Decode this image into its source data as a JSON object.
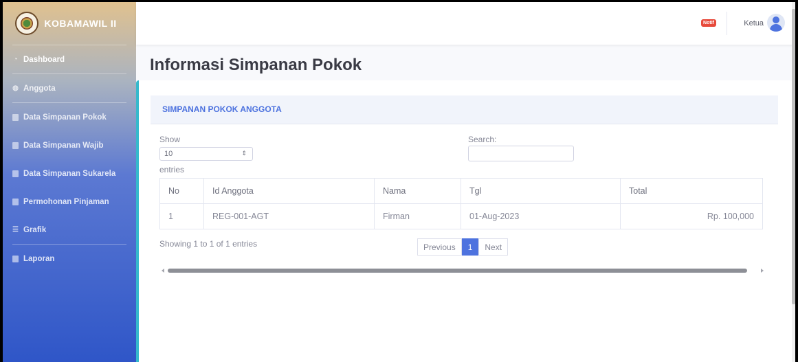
{
  "app": {
    "brand": "KOBAMAWIL II"
  },
  "sidebar": {
    "items": [
      {
        "label": "Dashboard",
        "icon": "dashboard-icon"
      },
      {
        "label": "Anggota",
        "icon": "user-circle-icon"
      },
      {
        "label": "Data Simpanan Pokok",
        "icon": "table-icon"
      },
      {
        "label": "Data Simpanan Wajib",
        "icon": "table-icon"
      },
      {
        "label": "Data Simpanan Sukarela",
        "icon": "table-icon"
      },
      {
        "label": "Permohonan Pinjaman",
        "icon": "file-icon"
      },
      {
        "label": "Grafik",
        "icon": "list-icon"
      },
      {
        "label": "Laporan",
        "icon": "print-icon"
      }
    ]
  },
  "topbar": {
    "notif_badge": "Notif",
    "user_name": "Ketua"
  },
  "page": {
    "title": "Informasi Simpanan Pokok"
  },
  "card": {
    "header": "SIMPANAN POKOK ANGGOTA",
    "show_label": "Show",
    "entries_value": "10",
    "entries_label": "entries",
    "search_label": "Search:",
    "search_value": ""
  },
  "table": {
    "columns": [
      "No",
      "Id Anggota",
      "Nama",
      "Tgl",
      "Total"
    ],
    "rows": [
      [
        "1",
        "REG-001-AGT",
        "Firman",
        "01-Aug-2023",
        "Rp. 100,000"
      ]
    ]
  },
  "footer": {
    "info": "Showing 1 to 1 of 1 entries",
    "previous": "Previous",
    "page": "1",
    "next": "Next"
  }
}
